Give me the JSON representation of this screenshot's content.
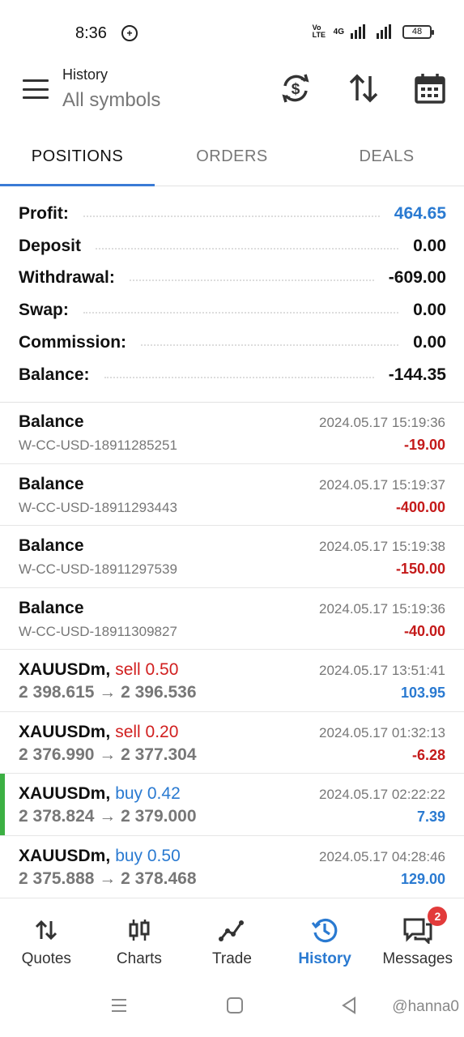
{
  "status_bar": {
    "time": "8:36",
    "network": "4G",
    "volte": "Vo LTE",
    "battery": "48"
  },
  "header": {
    "title": "History",
    "subtitle": "All symbols",
    "icons": [
      "currency-exchange-icon",
      "sort-icon",
      "calendar-icon"
    ]
  },
  "tabs": [
    {
      "label": "POSITIONS",
      "active": true
    },
    {
      "label": "ORDERS",
      "active": false
    },
    {
      "label": "DEALS",
      "active": false
    }
  ],
  "summary": [
    {
      "label": "Profit:",
      "value": "464.65"
    },
    {
      "label": "Deposit",
      "value": "0.00"
    },
    {
      "label": "Withdrawal:",
      "value": "-609.00"
    },
    {
      "label": "Swap:",
      "value": "0.00"
    },
    {
      "label": "Commission:",
      "value": "0.00"
    },
    {
      "label": "Balance:",
      "value": "-144.35"
    }
  ],
  "deals": [
    {
      "name": "Balance",
      "sub": "W-CC-USD-18911285251",
      "time": "2024.05.17 15:19:36",
      "amount": "-19.00"
    },
    {
      "name": "Balance",
      "sub": "W-CC-USD-18911293443",
      "time": "2024.05.17 15:19:37",
      "amount": "-400.00"
    },
    {
      "name": "Balance",
      "sub": "W-CC-USD-18911297539",
      "time": "2024.05.17 15:19:38",
      "amount": "-150.00"
    },
    {
      "name": "Balance",
      "sub": "W-CC-USD-18911309827",
      "time": "2024.05.17 15:19:36",
      "amount": "-40.00"
    }
  ],
  "positions": [
    {
      "symbol": "XAUUSDm,",
      "side": "sell 0.50",
      "prices": "2 398.615 → 2 396.536",
      "time": "2024.05.17 13:51:41",
      "amount": "103.95"
    },
    {
      "symbol": "XAUUSDm,",
      "side": "sell 0.20",
      "prices": "2 376.990 → 2 377.304",
      "time": "2024.05.17 01:32:13",
      "amount": "-6.28"
    },
    {
      "symbol": "XAUUSDm,",
      "side": "buy 0.42",
      "prices": "2 378.824 → 2 379.000",
      "time": "2024.05.17 02:22:22",
      "amount": "7.39"
    },
    {
      "symbol": "XAUUSDm,",
      "side": "buy 0.50",
      "prices": "2 375.888 → 2 378.468",
      "time": "2024.05.17 04:28:46",
      "amount": "129.00"
    }
  ],
  "bottom_nav": [
    {
      "label": "Quotes"
    },
    {
      "label": "Charts"
    },
    {
      "label": "Trade"
    },
    {
      "label": "History",
      "active": true
    },
    {
      "label": "Messages",
      "badge": "2"
    }
  ],
  "watermark": "@hanna0",
  "colors": {
    "accent_blue": "#2a7ad1",
    "loss_red": "#c41a1a",
    "sell_red": "#d11f1f",
    "buy_green": "#3cb043"
  }
}
